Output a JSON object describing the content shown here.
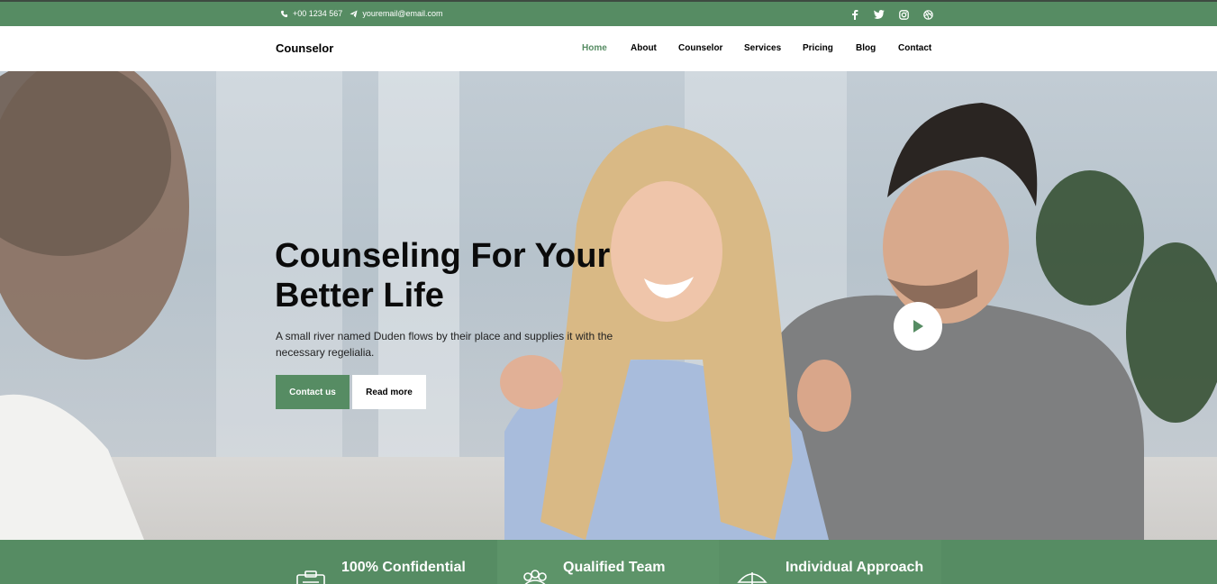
{
  "topbar": {
    "phone": "+00 1234 567",
    "email": "youremail@email.com",
    "social_icons": [
      "facebook-icon",
      "twitter-icon",
      "instagram-icon",
      "dribbble-icon"
    ]
  },
  "navbar": {
    "brand": "Counselor",
    "items": [
      {
        "label": "Home",
        "active": true
      },
      {
        "label": "About",
        "active": false
      },
      {
        "label": "Counselor",
        "active": false
      },
      {
        "label": "Services",
        "active": false
      },
      {
        "label": "Pricing",
        "active": false
      },
      {
        "label": "Blog",
        "active": false
      },
      {
        "label": "Contact",
        "active": false
      }
    ]
  },
  "hero": {
    "headline": "Counseling For Your Better Life",
    "subtext": "A small river named Duden flows by their place and supplies it with the necessary regelialia.",
    "primary_button": "Contact us",
    "secondary_button": "Read more"
  },
  "features": [
    {
      "title": "100% Confidential",
      "icon": "clipboard-icon"
    },
    {
      "title": "Qualified Team",
      "icon": "team-icon"
    },
    {
      "title": "Individual Approach",
      "icon": "umbrella-icon"
    }
  ],
  "colors": {
    "accent": "#568c63",
    "topbar_border": "#3e4a41"
  }
}
